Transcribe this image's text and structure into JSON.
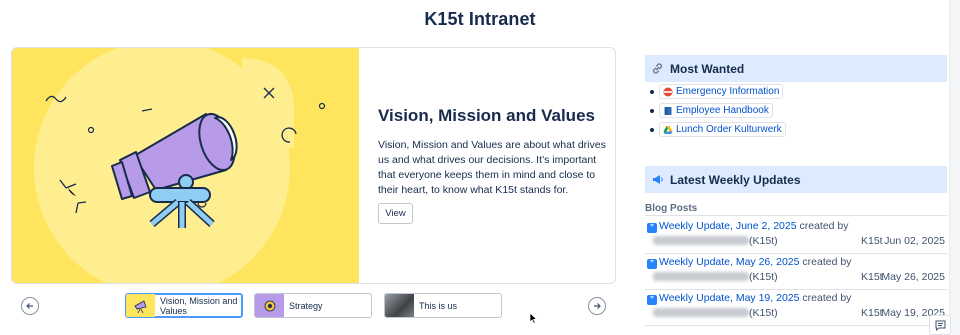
{
  "page": {
    "title": "K15t Intranet"
  },
  "carousel": {
    "slide": {
      "title": "Vision, Mission and Values",
      "description": "Vision, Mission and Values are about what drives us and what drives our decisions. It’s important that everyone keeps them in mind and close to their heart, to know what K15t stands for.",
      "button_label": "View",
      "illustration": "telescope-illustration"
    },
    "prev_icon": "arrow-left-icon",
    "next_icon": "arrow-right-icon",
    "thumbnails": [
      {
        "label": "Vision, Mission and Values",
        "active": true,
        "color": "#ffe55e"
      },
      {
        "label": "Strategy",
        "active": false,
        "color": "#b89be8"
      },
      {
        "label": "This is us",
        "active": false,
        "color": "#6b6f76"
      }
    ]
  },
  "most_wanted": {
    "title": "Most Wanted",
    "icon": "link-icon",
    "links": [
      {
        "label": "Emergency Information",
        "icon": "emergency-icon"
      },
      {
        "label": "Employee Handbook",
        "icon": "book-icon"
      },
      {
        "label": "Lunch Order Kulturwerk",
        "icon": "google-drive-icon"
      }
    ]
  },
  "weekly_updates": {
    "title": "Latest Weekly Updates",
    "icon": "megaphone-icon",
    "section_label": "Blog Posts",
    "posts": [
      {
        "title": "Weekly Update, June 2, 2025",
        "created_by": "created by",
        "space_paren": "(K15t)",
        "space": "K15t",
        "date": "Jun 02, 2025"
      },
      {
        "title": "Weekly Update, May 26, 2025",
        "created_by": "created by",
        "space_paren": "(K15t)",
        "space": "K15t",
        "date": "May 26, 2025"
      },
      {
        "title": "Weekly Update, May 19, 2025",
        "created_by": "created by",
        "space_paren": "(K15t)",
        "space": "K15t",
        "date": "May 19, 2025"
      }
    ]
  },
  "colors": {
    "accent": "#0052cc",
    "panel_header": "#deebff",
    "hero_yellow": "#ffe55e",
    "telescope_purple": "#b89be8",
    "tripod_blue": "#8fcdf2"
  }
}
